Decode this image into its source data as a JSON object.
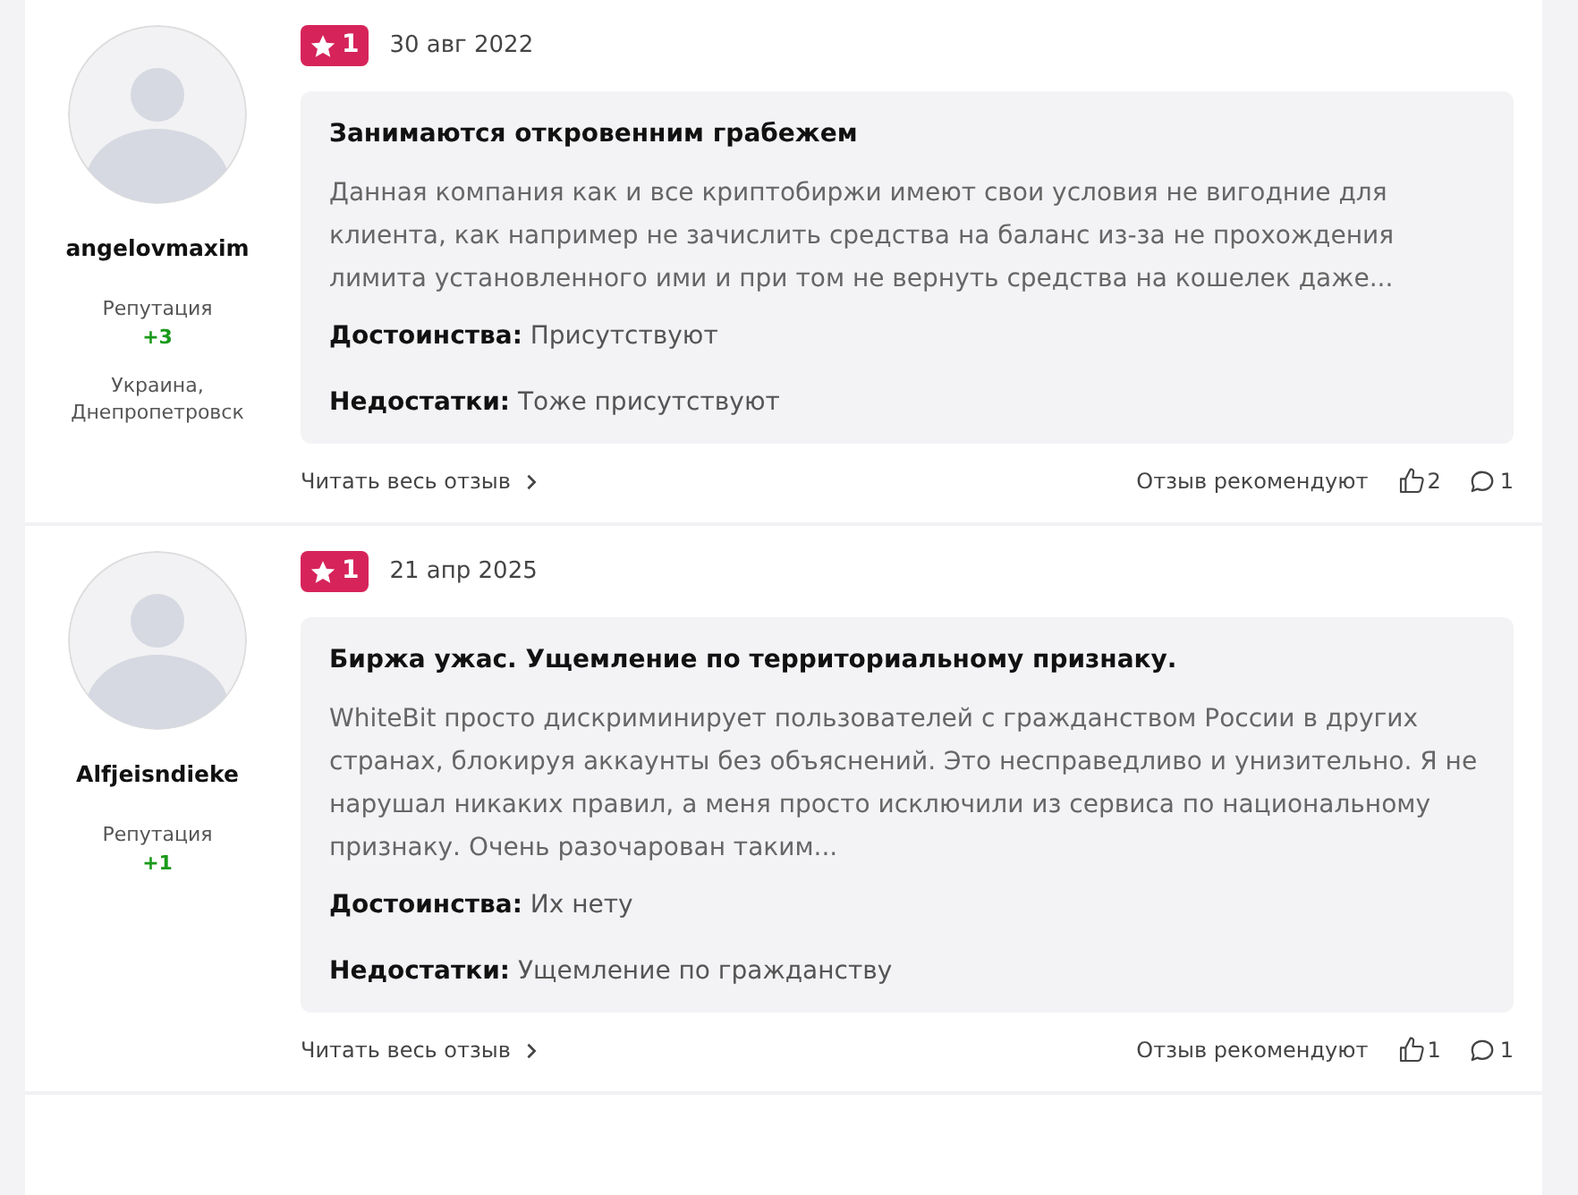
{
  "reviews": [
    {
      "author": "angelovmaxim",
      "reputation_label": "Репутация",
      "reputation": "+3",
      "location": [
        "Украина,",
        "Днепропетровск"
      ],
      "rating": "1",
      "date": "30 авг 2022",
      "title": "Занимаются откровенним грабежем",
      "text": "Данная компания как и все криптобиржи имеют свои условия не вигодние для клиента, как например не зачислить средства на баланс из-за не прохождения лимита установленного ими и при том не вернуть средства на кошелек даже...",
      "pros": "**Достоинства:** Присутствуют",
      "cons": "**Недостатки:** Тоже присутствуют",
      "read_more": "Читать весь отзыв",
      "recommend_label": "Отзыв рекомендуют",
      "likes": "2",
      "comments": "1"
    },
    {
      "author": "Alfjeisndieke",
      "reputation_label": "Репутация",
      "reputation": "+1",
      "rating": "1",
      "date": "21 апр 2025",
      "title": "Биржа ужас. Ущемление по территориальному признаку.",
      "text": "WhiteBit просто дискриминирует пользователей с гражданством России в других странах, блокируя аккаунты без объяснений. Это несправедливо и унизительно. Я не нарушал никаких правил, а меня просто исключили из сервиса по национальному признаку. Очень разочарован таким...",
      "pros": "**Достоинства:** Их нету",
      "cons": "**Недостатки:** Ущемление по гражданству",
      "read_more": "Читать весь отзыв",
      "recommend_label": "Отзыв рекомендуют",
      "likes": "1",
      "comments": "1"
    }
  ]
}
